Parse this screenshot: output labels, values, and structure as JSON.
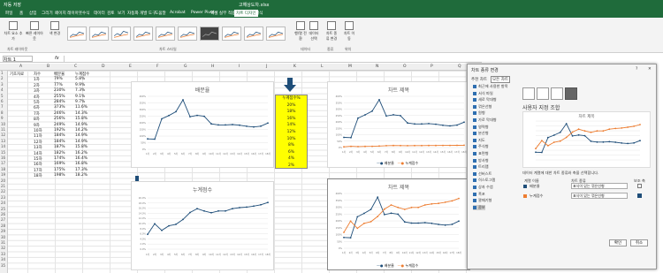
{
  "titlebar": {
    "autosave": "자동 저장",
    "filename": "고해상도차.xlsx"
  },
  "tabs": [
    "파일",
    "홈",
    "삽입",
    "그리기",
    "페이지 레이아웃",
    "수식",
    "데이터",
    "검토",
    "보기",
    "자동화",
    "개발 도구",
    "도움말",
    "Acrobat",
    "Power Pivot",
    "엑셀 실무 적용",
    "차트 디자인",
    "서식"
  ],
  "ribbon": {
    "add_element": "차트 요소 추가",
    "quick_layout": "빠른 레이아웃",
    "change_colors": "색 변경",
    "switch": "행/열 전환",
    "select_data": "데이터 선택",
    "change_type": "차트 종류 변경",
    "move_chart": "차트 이동",
    "group_layout": "차트 레이아웃",
    "group_styles": "차트 스타일",
    "group_data": "데이터",
    "group_type": "종류",
    "group_location": "위치"
  },
  "namebox": "차트 1",
  "fx": "fx",
  "columns": [
    "A",
    "B",
    "C",
    "D",
    "E",
    "F",
    "G",
    "H",
    "I",
    "J",
    "K",
    "L",
    "M",
    "N",
    "O",
    "P",
    "Q"
  ],
  "table": {
    "headers": [
      "기초자료",
      "차수",
      "배분율",
      "누계점수"
    ],
    "rows": [
      [
        "1차",
        "79%",
        "5.8%"
      ],
      [
        "2차",
        "77%",
        "9.9%"
      ],
      [
        "3차",
        "230%",
        "7.3%"
      ],
      [
        "4차",
        "255%",
        "9.1%"
      ],
      [
        "5차",
        "284%",
        "9.7%"
      ],
      [
        "6차",
        "373%",
        "11.6%"
      ],
      [
        "7차",
        "246%",
        "14.3%"
      ],
      [
        "8차",
        "256%",
        "15.8%"
      ],
      [
        "9차",
        "249%",
        "14.9%"
      ],
      [
        "10차",
        "192%",
        "14.2%"
      ],
      [
        "11차",
        "184%",
        "14.9%"
      ],
      [
        "12차",
        "184%",
        "14.9%"
      ],
      [
        "13차",
        "187%",
        "15.8%"
      ],
      [
        "14차",
        "182%",
        "16.2%"
      ],
      [
        "15차",
        "174%",
        "16.4%"
      ],
      [
        "16차",
        "169%",
        "16.8%"
      ],
      [
        "17차",
        "175%",
        "17.3%"
      ],
      [
        "18차",
        "198%",
        "18.2%"
      ]
    ]
  },
  "chart1": {
    "title": "배분율"
  },
  "chart2": {
    "title": "누계점수"
  },
  "chart3": {
    "title": "차트 제목",
    "legend": [
      "배분율",
      "누계점수"
    ]
  },
  "chart4": {
    "title": "차트 제목",
    "legend": [
      "배분율",
      "누계점수"
    ]
  },
  "yellow": {
    "header": "누계점수%",
    "values": [
      "20%",
      "18%",
      "16%",
      "14%",
      "12%",
      "10%",
      "8%",
      "6%",
      "4%",
      "2%"
    ]
  },
  "panel": {
    "title": "차트 종류 변경",
    "help": "?",
    "close": "✕",
    "tab_recommended": "추천 차트",
    "tab_all": "모든 차트",
    "types": [
      "최근에 사용한 항목",
      "서식 파일",
      "세로 막대형",
      "꺾은선형",
      "원형",
      "가로 막대형",
      "영역형",
      "분산형",
      "지도",
      "주식형",
      "표면형",
      "방사형",
      "트리맵",
      "선버스트",
      "히스토그램",
      "상자 수염",
      "폭포",
      "깔때기형",
      "콤보"
    ],
    "subtitle": "사용자 지정 조합",
    "preview_title": "차트 제목",
    "instruction": "데이터 계열에 대한 차트 종류와 축을 선택합니다.",
    "col_series": "계열 이름",
    "col_type": "차트 종류",
    "col_axis": "보조 축",
    "series": [
      {
        "name": "배분율",
        "type": "표식이 있는 꺾은선형"
      },
      {
        "name": "누계점수",
        "type": "표식이 있는 꺾은선형"
      }
    ],
    "ok": "확인",
    "cancel": "취소"
  },
  "colors": {
    "excel_green": "#1f6b3b",
    "series1": "#1f4e79",
    "series2": "#ed7d31",
    "yellow": "#ffff00"
  }
}
